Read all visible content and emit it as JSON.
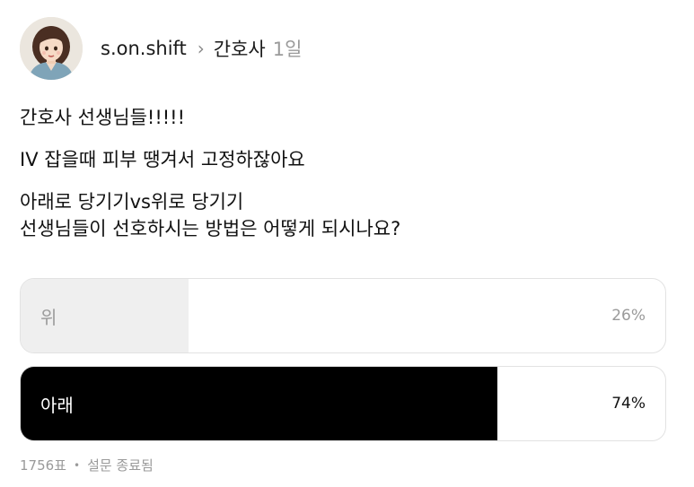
{
  "post": {
    "username": "s.on.shift",
    "topic": "간호사",
    "time": "1일",
    "paragraphs": [
      [
        "간호사 선생님들!!!!!"
      ],
      [
        "IV 잡을때 피부 땡겨서 고정하잖아요"
      ],
      [
        "아래로 당기기vs위로 당기기",
        "선생님들이 선호하시는 방법은 어떻게 되시나요?"
      ]
    ]
  },
  "poll": {
    "options": [
      {
        "label": "위",
        "percent_text": "26%",
        "fraction": 0.26,
        "fill_color": "#efefef"
      },
      {
        "label": "아래",
        "percent_text": "74%",
        "fraction": 0.74,
        "fill_color": "#000000"
      }
    ],
    "votes": "1756표",
    "status": "설문 종료됨"
  },
  "icons": {
    "chevron": "›",
    "separator": "•"
  }
}
